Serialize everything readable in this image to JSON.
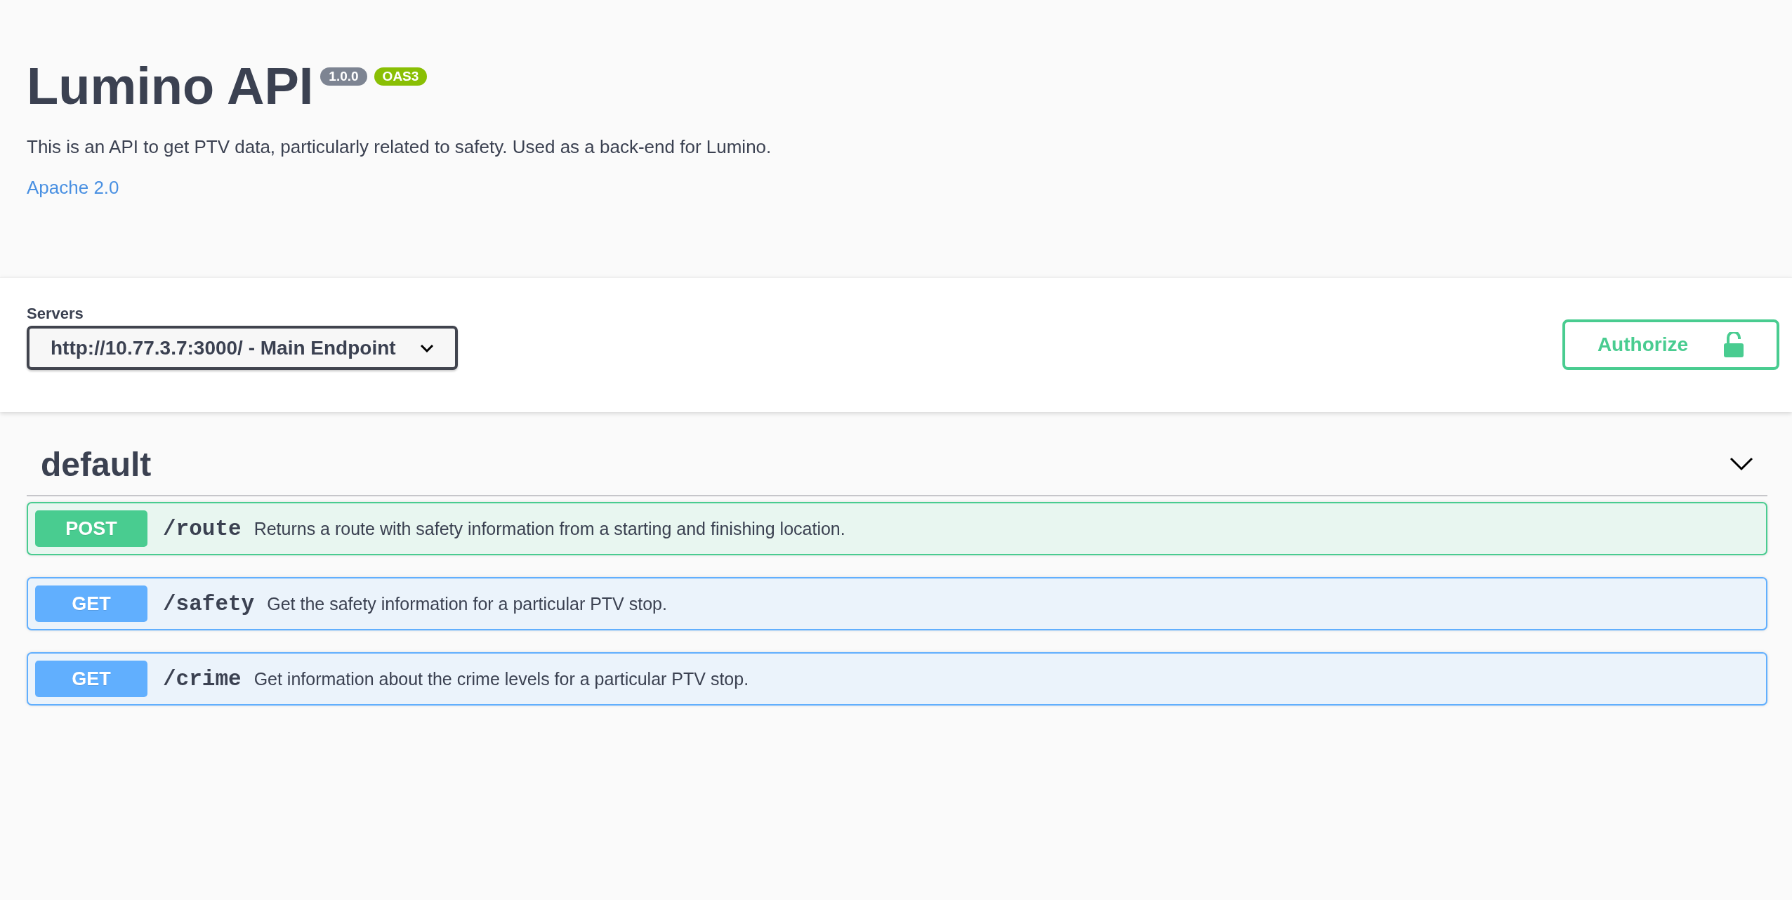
{
  "info": {
    "title": "Lumino API",
    "version": "1.0.0",
    "spec_badge": "OAS3",
    "description": "This is an API to get PTV data, particularly related to safety. Used as a back-end for Lumino.",
    "license_link": "Apache 2.0"
  },
  "servers": {
    "label": "Servers",
    "selected": "http://10.77.3.7:3000/ - Main Endpoint"
  },
  "authorize": {
    "label": "Authorize",
    "locked": false
  },
  "tag": {
    "name": "default",
    "expanded": true
  },
  "operations": [
    {
      "kind": "post",
      "method": "POST",
      "path": "/route",
      "summary": "Returns a route with safety information from a starting and finishing location."
    },
    {
      "kind": "get",
      "method": "GET",
      "path": "/safety",
      "summary": "Get the safety information for a particular PTV stop."
    },
    {
      "kind": "get",
      "method": "GET",
      "path": "/crime",
      "summary": "Get information about the crime levels for a particular PTV stop."
    }
  ]
}
